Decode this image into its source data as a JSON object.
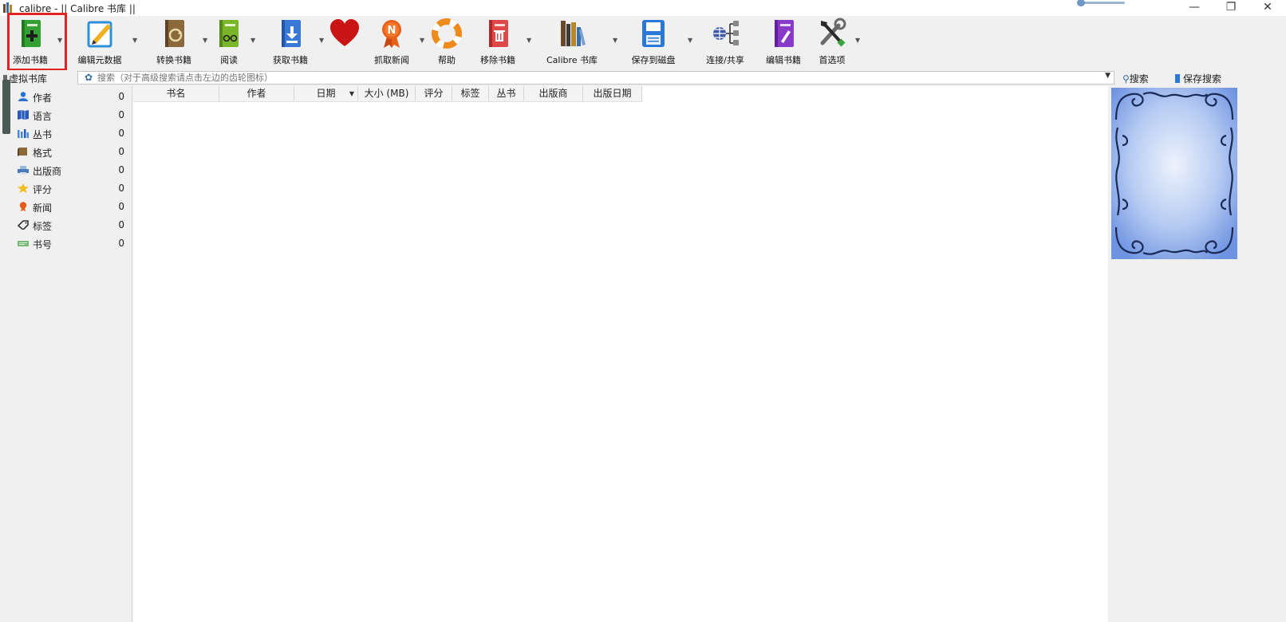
{
  "window": {
    "title": "calibre - || Calibre 书库 ||",
    "controls": {
      "minimize": "—",
      "maximize": "❐",
      "close": "✕"
    }
  },
  "toolbar": {
    "items": [
      {
        "label": "添加书籍",
        "icon": "add-book-icon",
        "color": "#3aa23a"
      },
      {
        "label": "编辑元数据",
        "icon": "edit-metadata-icon",
        "color": "#2f8fd8"
      },
      {
        "label": "转换书籍",
        "icon": "convert-book-icon",
        "color": "#8a6a3a"
      },
      {
        "label": "阅读",
        "icon": "read-book-icon",
        "color": "#7ab62a"
      },
      {
        "label": "获取书籍",
        "icon": "get-books-icon",
        "color": "#3a78d8"
      },
      {
        "label": "",
        "icon": "donate-heart-icon",
        "color": "#c81414"
      },
      {
        "label": "抓取新闻",
        "icon": "fetch-news-icon",
        "color": "#e8601a"
      },
      {
        "label": "帮助",
        "icon": "help-lifebuoy-icon",
        "color": "#f08a1a"
      },
      {
        "label": "移除书籍",
        "icon": "remove-book-icon",
        "color": "#e04848"
      },
      {
        "label": "Calibre 书库",
        "icon": "library-books-icon",
        "color": "#6a4a2a"
      },
      {
        "label": "保存到磁盘",
        "icon": "save-disk-icon",
        "color": "#2a78d8"
      },
      {
        "label": "连接/共享",
        "icon": "connect-share-icon",
        "color": "#3a5aa8"
      },
      {
        "label": "编辑书籍",
        "icon": "edit-book-icon",
        "color": "#8a3ac8"
      },
      {
        "label": "首选项",
        "icon": "preferences-tools-icon",
        "color": "#444444"
      }
    ]
  },
  "search": {
    "virtual_library": "虚拟书库",
    "placeholder": "搜索（对于高级搜索请点击左边的齿轮图标）",
    "search_button": "搜索",
    "save_search_button": "保存搜索"
  },
  "tag_browser": {
    "items": [
      {
        "label": "作者",
        "count": "0",
        "icon": "author-icon"
      },
      {
        "label": "语言",
        "count": "0",
        "icon": "language-icon"
      },
      {
        "label": "丛书",
        "count": "0",
        "icon": "series-icon"
      },
      {
        "label": "格式",
        "count": "0",
        "icon": "format-icon"
      },
      {
        "label": "出版商",
        "count": "0",
        "icon": "publisher-icon"
      },
      {
        "label": "评分",
        "count": "0",
        "icon": "rating-icon"
      },
      {
        "label": "新闻",
        "count": "0",
        "icon": "news-icon"
      },
      {
        "label": "标签",
        "count": "0",
        "icon": "tag-icon"
      },
      {
        "label": "书号",
        "count": "0",
        "icon": "identifier-icon"
      }
    ]
  },
  "book_list": {
    "columns": [
      "书名",
      "作者",
      "日期",
      "大小 (MB)",
      "评分",
      "标签",
      "丛书",
      "出版商",
      "出版日期"
    ],
    "sort_indicator": "▼"
  },
  "colors": {
    "highlight_box": "#e02424",
    "cover_blue": "#7aa0e8"
  }
}
